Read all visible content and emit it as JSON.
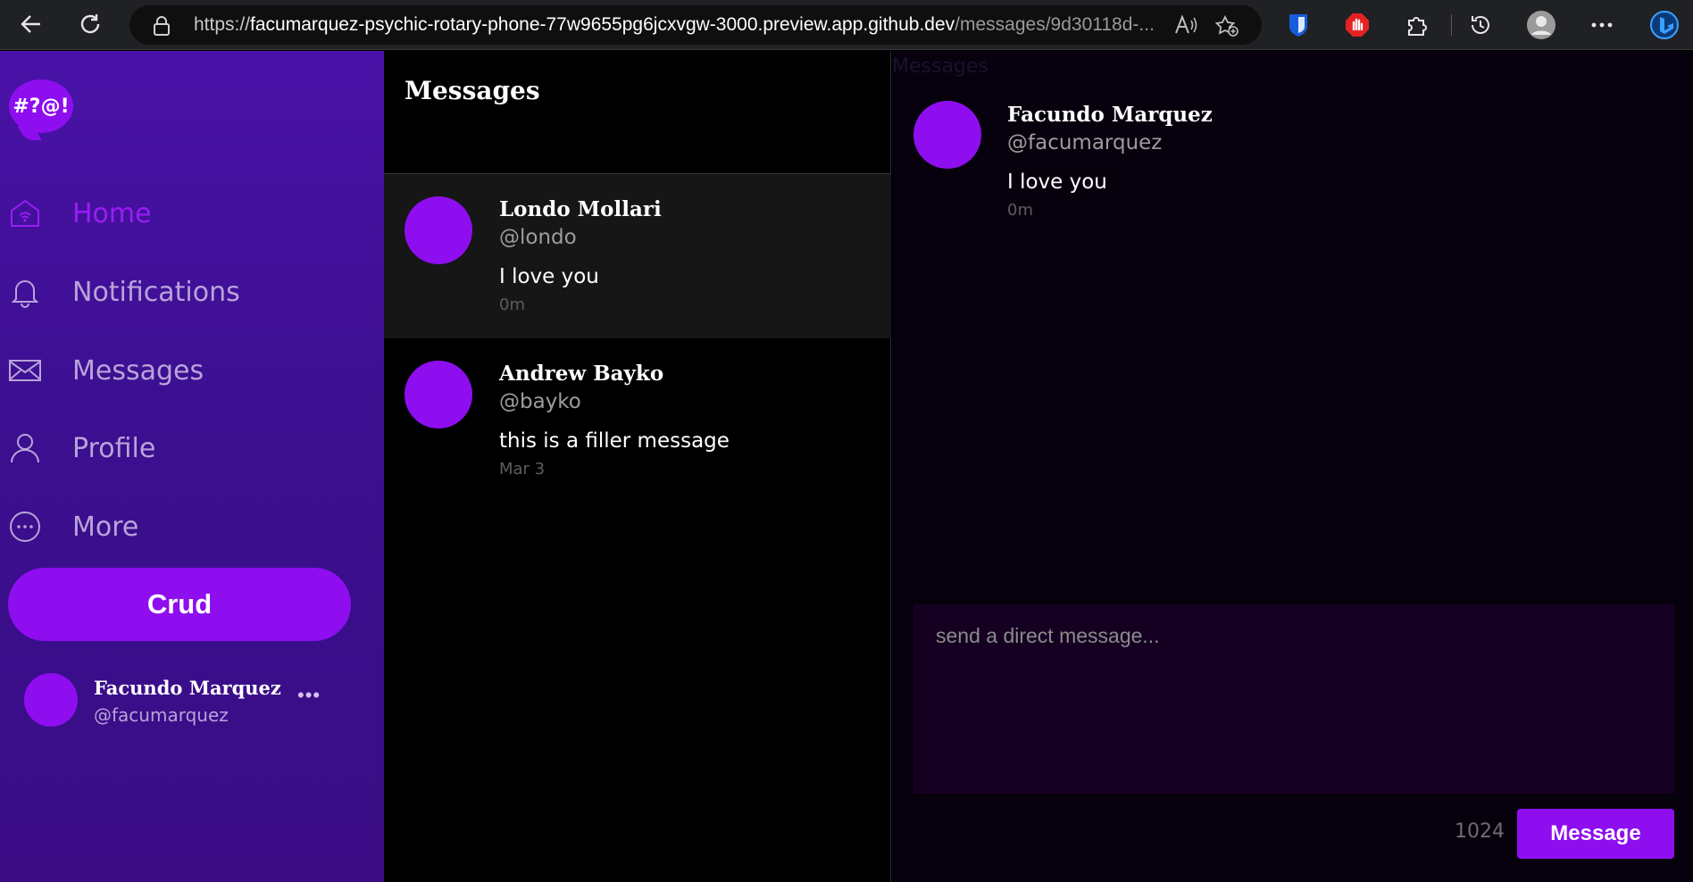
{
  "browser": {
    "url_prefix": "https://",
    "url_host": "facumarquez-psychic-rotary-phone-77w9655pg6jcxvgw-3000.preview.app.github.dev",
    "url_path": "/messages/9d30118d-..."
  },
  "sidebar": {
    "logo_text": "#?@!",
    "items": [
      {
        "label": "Home",
        "icon": "home-icon",
        "active": true
      },
      {
        "label": "Notifications",
        "icon": "bell-icon",
        "active": false
      },
      {
        "label": "Messages",
        "icon": "envelope-icon",
        "active": false
      },
      {
        "label": "Profile",
        "icon": "user-icon",
        "active": false
      },
      {
        "label": "More",
        "icon": "more-circle-icon",
        "active": false
      }
    ],
    "crud_label": "Crud",
    "account": {
      "name": "Facundo Marquez",
      "handle": "@facumarquez",
      "more": "•••"
    }
  },
  "conversations": {
    "title": "Messages",
    "items": [
      {
        "name": "Londo Mollari",
        "handle": "@londo",
        "message": "I love you",
        "time": "0m",
        "selected": true
      },
      {
        "name": "Andrew Bayko",
        "handle": "@bayko",
        "message": "this is a filler message",
        "time": "Mar 3",
        "selected": false
      }
    ]
  },
  "thread": {
    "ghost_title": "Messages",
    "message": {
      "name": "Facundo Marquez",
      "handle": "@facumarquez",
      "text": "I love you",
      "time": "0m"
    },
    "compose_placeholder": "send a direct message...",
    "char_count": "1024",
    "send_label": "Message"
  },
  "colors": {
    "accent": "#8e0ef0",
    "sidebar_bg": "#3f0f95",
    "thread_bg": "#07000d"
  }
}
